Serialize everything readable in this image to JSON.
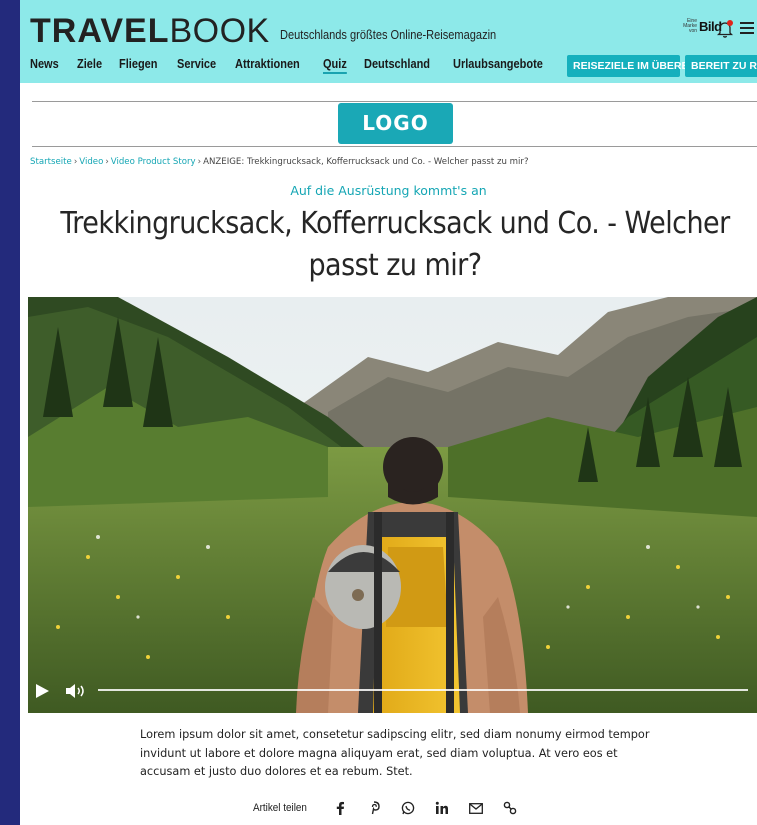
{
  "header": {
    "brand_bold": "TRAVEL",
    "brand_light": "BOOK",
    "tagline": "Deutschlands größtes Online-Reisemagazin",
    "bild_small": "Eine\nMarke\nvon",
    "bild_logo": "Bild",
    "nav": [
      "News",
      "Ziele",
      "Fliegen",
      "Service",
      "Attraktionen",
      "Quiz",
      "Deutschland",
      "Urlaubsangebote"
    ],
    "active_nav": "Quiz",
    "btn_1": "REISEZIELE IM ÜBERBLICK",
    "btn_2": "BEREIT ZU REISEN"
  },
  "logo": "LOGO",
  "breadcrumb": {
    "links": [
      "Startseite",
      "Video",
      "Video Product Story"
    ],
    "current": "ANZEIGE: Trekkingrucksack, Kofferrucksack und Co. - Welcher passt zu mir?"
  },
  "article": {
    "kicker": "Auf die Ausrüstung kommt's an",
    "headline_line1": "Trekkingrucksack, Kofferrucksack und Co. - Welcher",
    "headline_line2": "passt zu mir?",
    "description": "Lorem ipsum dolor sit amet, consetetur sadipscing elitr, sed diam nonumy eirmod tempor invidunt ut labore et dolore magna aliquyam erat, sed diam voluptua. At vero eos et accusam et justo duo dolores et ea rebum. Stet."
  },
  "share": {
    "label": "Artikel teilen",
    "icons": [
      "facebook-icon",
      "pinterest-icon",
      "whatsapp-icon",
      "linkedin-icon",
      "mail-icon",
      "link-icon"
    ]
  },
  "colors": {
    "header_bg": "#8de9e9",
    "accent": "#15a6b4",
    "page_bg": "#232a7c"
  }
}
